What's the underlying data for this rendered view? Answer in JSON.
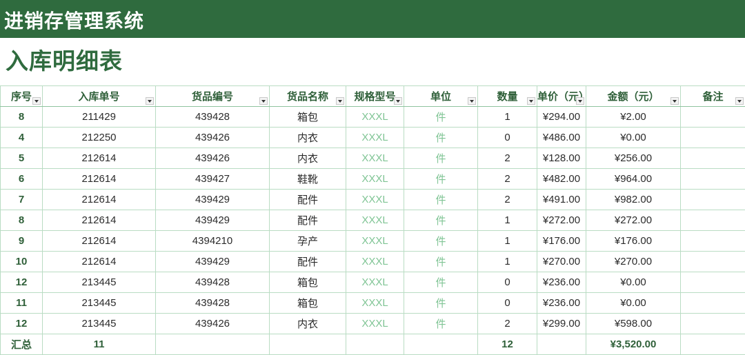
{
  "app_title": "进销存管理系统",
  "page_title": "入库明细表",
  "columns": [
    "序号",
    "入库单号",
    "货品编号",
    "货品名称",
    "规格型号",
    "单位",
    "数量",
    "单价（元）",
    "金额（元）",
    "备注"
  ],
  "rows": [
    {
      "seq": "8",
      "order": "211429",
      "code": "439428",
      "name": "箱包",
      "spec": "XXXL",
      "unit": "件",
      "qty": "1",
      "price": "¥294.00",
      "amount": "¥2.00",
      "note": ""
    },
    {
      "seq": "4",
      "order": "212250",
      "code": "439426",
      "name": "内衣",
      "spec": "XXXL",
      "unit": "件",
      "qty": "0",
      "price": "¥486.00",
      "amount": "¥0.00",
      "note": ""
    },
    {
      "seq": "5",
      "order": "212614",
      "code": "439426",
      "name": "内衣",
      "spec": "XXXL",
      "unit": "件",
      "qty": "2",
      "price": "¥128.00",
      "amount": "¥256.00",
      "note": ""
    },
    {
      "seq": "6",
      "order": "212614",
      "code": "439427",
      "name": "鞋靴",
      "spec": "XXXL",
      "unit": "件",
      "qty": "2",
      "price": "¥482.00",
      "amount": "¥964.00",
      "note": ""
    },
    {
      "seq": "7",
      "order": "212614",
      "code": "439429",
      "name": "配件",
      "spec": "XXXL",
      "unit": "件",
      "qty": "2",
      "price": "¥491.00",
      "amount": "¥982.00",
      "note": ""
    },
    {
      "seq": "8",
      "order": "212614",
      "code": "439429",
      "name": "配件",
      "spec": "XXXL",
      "unit": "件",
      "qty": "1",
      "price": "¥272.00",
      "amount": "¥272.00",
      "note": ""
    },
    {
      "seq": "9",
      "order": "212614",
      "code": "4394210",
      "name": "孕产",
      "spec": "XXXL",
      "unit": "件",
      "qty": "1",
      "price": "¥176.00",
      "amount": "¥176.00",
      "note": ""
    },
    {
      "seq": "10",
      "order": "212614",
      "code": "439429",
      "name": "配件",
      "spec": "XXXL",
      "unit": "件",
      "qty": "1",
      "price": "¥270.00",
      "amount": "¥270.00",
      "note": ""
    },
    {
      "seq": "12",
      "order": "213445",
      "code": "439428",
      "name": "箱包",
      "spec": "XXXL",
      "unit": "件",
      "qty": "0",
      "price": "¥236.00",
      "amount": "¥0.00",
      "note": ""
    },
    {
      "seq": "11",
      "order": "213445",
      "code": "439428",
      "name": "箱包",
      "spec": "XXXL",
      "unit": "件",
      "qty": "0",
      "price": "¥236.00",
      "amount": "¥0.00",
      "note": ""
    },
    {
      "seq": "12",
      "order": "213445",
      "code": "439426",
      "name": "内衣",
      "spec": "XXXL",
      "unit": "件",
      "qty": "2",
      "price": "¥299.00",
      "amount": "¥598.00",
      "note": ""
    }
  ],
  "totals": {
    "label": "汇总",
    "order_count": "11",
    "qty": "12",
    "amount": "¥3,520.00"
  },
  "colors": {
    "header_bar": "#2f6b3e",
    "accent_text": "#2e5f38",
    "muted_text": "#7fc494",
    "grid_line": "#b9dcc3"
  }
}
